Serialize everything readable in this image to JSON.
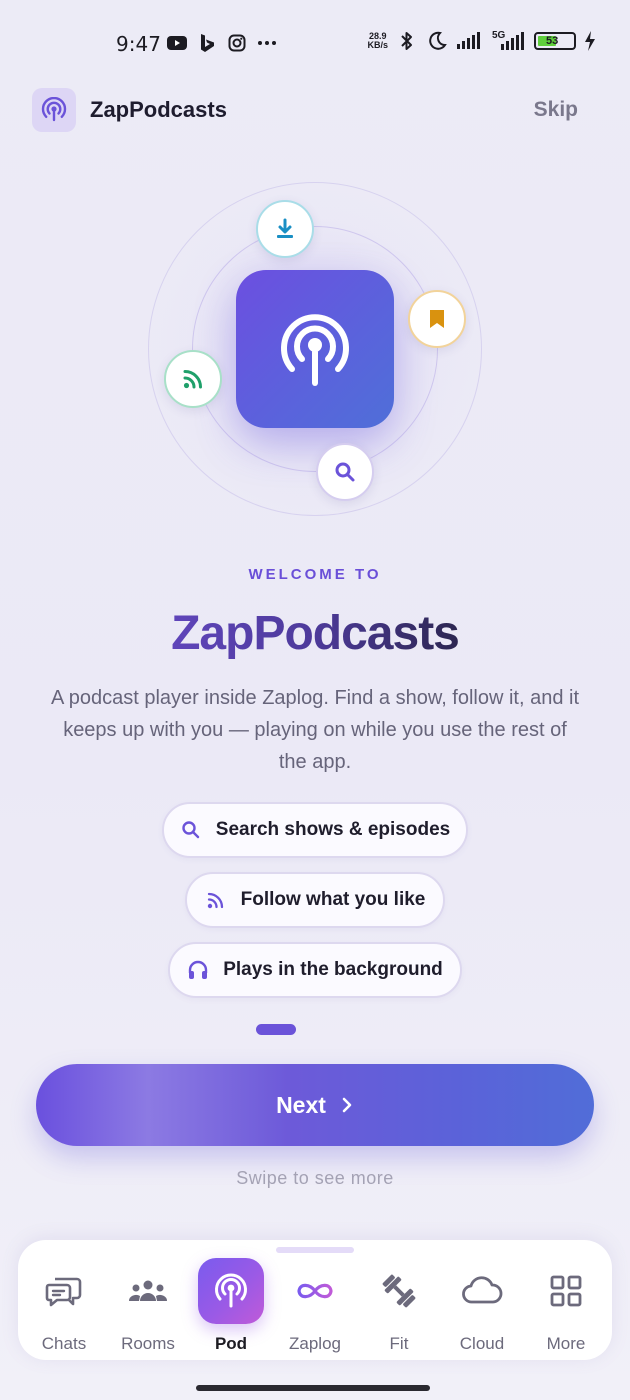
{
  "status_bar": {
    "time": "9:47",
    "net_speed_value": "28.9",
    "net_speed_unit": "KB/s",
    "network": "5G",
    "battery": "53",
    "battery_level_percent": 53,
    "icons": [
      "youtube-icon",
      "bing-icon",
      "instagram-icon",
      "more-dots-icon",
      "bluetooth-icon",
      "moon-icon",
      "signal-icon",
      "signal-5g-icon",
      "battery-icon",
      "charging-icon"
    ]
  },
  "header": {
    "app_name": "ZapPodcasts",
    "skip_label": "Skip"
  },
  "hero": {
    "center_icon": "podcast-broadcast-icon",
    "orbit_icons": [
      "download-icon",
      "bookmark-icon",
      "rss-icon",
      "search-icon"
    ],
    "colors": {
      "accent": "#6b53d9",
      "download": "#1a8fc4",
      "bookmark": "#d9920f",
      "rss": "#1fa06a",
      "search": "#6b53d9"
    }
  },
  "welcome": {
    "eyebrow": "WELCOME TO",
    "title": "ZapPodcasts",
    "description": "A podcast player inside Zaplog. Find a show, follow it, and it keeps up with you — playing on while you use the rest of the app."
  },
  "features": [
    {
      "icon": "search-icon",
      "label": "Search shows & episodes"
    },
    {
      "icon": "rss-icon",
      "label": "Follow what you like"
    },
    {
      "icon": "headphones-icon",
      "label": "Plays in the background"
    }
  ],
  "pager": {
    "current": 1
  },
  "next_button": {
    "label": "Next"
  },
  "swipe_hint": "Swipe to see more",
  "bottom_nav": {
    "items": [
      {
        "icon": "chat-icon",
        "label": "Chats"
      },
      {
        "icon": "rooms-icon",
        "label": "Rooms"
      },
      {
        "icon": "podcast-icon",
        "label": "Pod",
        "active": true
      },
      {
        "icon": "infinity-icon",
        "label": "Zaplog"
      },
      {
        "icon": "dumbbell-icon",
        "label": "Fit"
      },
      {
        "icon": "cloud-icon",
        "label": "Cloud"
      },
      {
        "icon": "grid-icon",
        "label": "More"
      }
    ]
  }
}
